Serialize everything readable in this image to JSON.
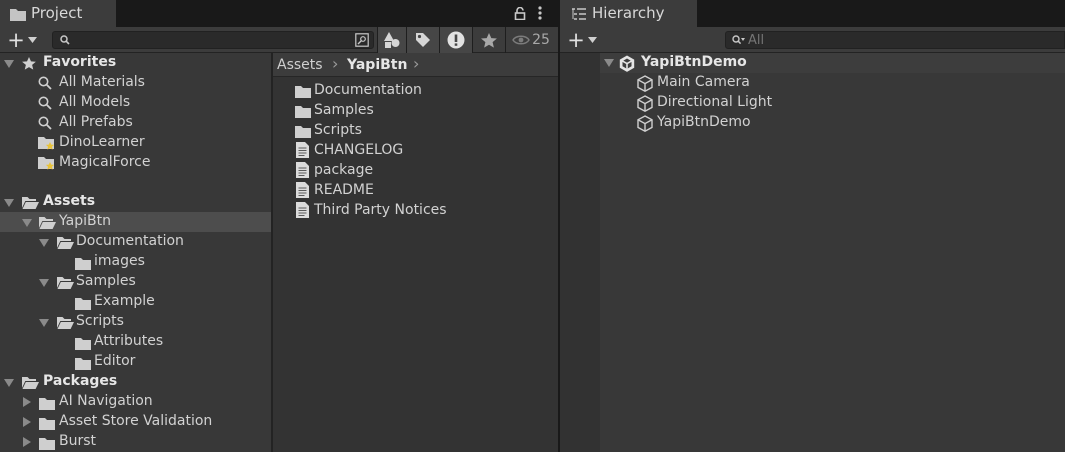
{
  "project": {
    "tab_title": "Project",
    "add_symbol": "+",
    "search_placeholder": "",
    "visible_count": "25",
    "favorites": {
      "label": "Favorites",
      "items": [
        "All Materials",
        "All Models",
        "All Prefabs",
        "DinoLearner",
        "MagicalForce"
      ]
    },
    "assets": {
      "label": "Assets",
      "yapibtn": "YapiBtn",
      "documentation": "Documentation",
      "images": "images",
      "samples": "Samples",
      "example": "Example",
      "scripts": "Scripts",
      "attributes": "Attributes",
      "editor": "Editor"
    },
    "packages": {
      "label": "Packages",
      "items": [
        "AI Navigation",
        "Asset Store Validation",
        "Burst"
      ]
    },
    "breadcrumb": {
      "root": "Assets",
      "current": "YapiBtn",
      "chevron": "›"
    },
    "contents": {
      "folders": [
        "Documentation",
        "Samples",
        "Scripts"
      ],
      "files": [
        "CHANGELOG",
        "package",
        "README",
        "Third Party Notices"
      ]
    }
  },
  "hierarchy": {
    "tab_title": "Hierarchy",
    "add_symbol": "+",
    "search_placeholder": "All",
    "scene": "YapiBtnDemo",
    "objects": [
      "Main Camera",
      "Directional Light",
      "YapiBtnDemo"
    ]
  },
  "colors": {
    "panel_bg": "#383838",
    "content_bg": "#333333",
    "selected_row": "#4d4d4d",
    "tab_active": "#3c3c3c",
    "tab_strip": "#191919"
  }
}
